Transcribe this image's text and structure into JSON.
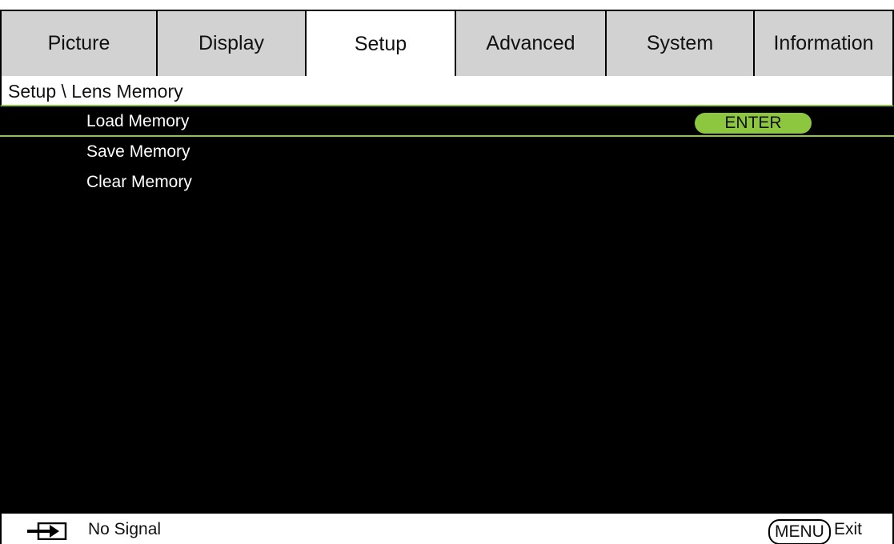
{
  "tabs": [
    {
      "label": "Picture",
      "active": false
    },
    {
      "label": "Display",
      "active": false
    },
    {
      "label": "Setup",
      "active": true
    },
    {
      "label": "Advanced",
      "active": false
    },
    {
      "label": "System",
      "active": false
    },
    {
      "label": "Information",
      "active": false
    }
  ],
  "breadcrumb": "Setup \\ Lens Memory",
  "menu": {
    "items": [
      {
        "label": "Load Memory",
        "selected": true,
        "action": "ENTER"
      },
      {
        "label": "Save Memory",
        "selected": false
      },
      {
        "label": "Clear Memory",
        "selected": false
      }
    ]
  },
  "footer": {
    "source_icon": "input-source-arrow-icon",
    "status": "No Signal",
    "menu_key": "MENU",
    "exit_label": "Exit"
  },
  "colors": {
    "accent": "#8dc63f",
    "tab_inactive": "#d2d2d2",
    "content_bg": "#000000"
  }
}
